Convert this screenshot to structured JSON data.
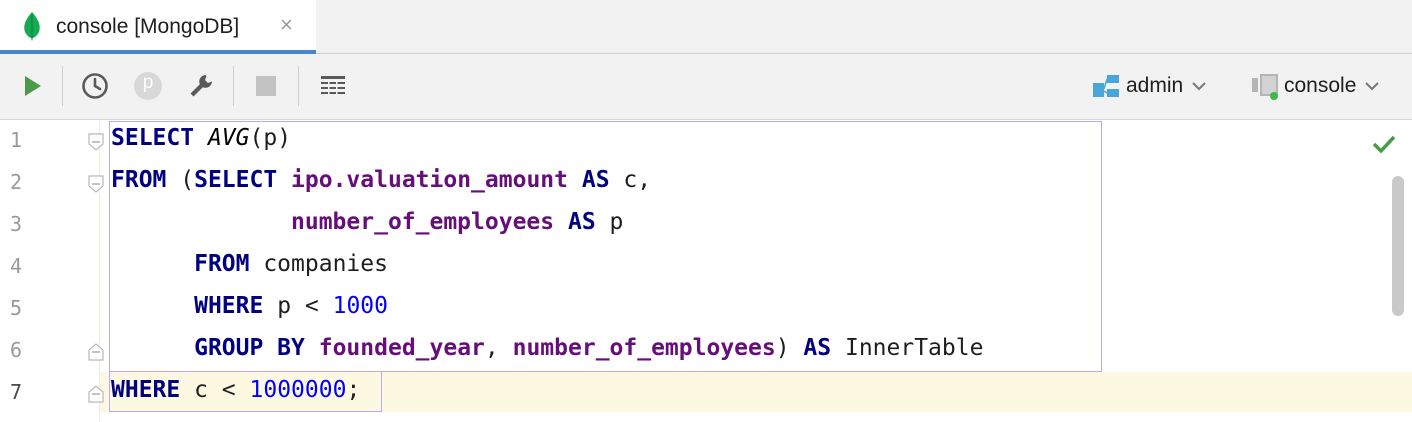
{
  "tab": {
    "label": "console [MongoDB]",
    "close": "×",
    "icon": "mongodb-leaf-icon"
  },
  "toolbar": {
    "param_label": "p",
    "db_selector": {
      "label": "admin",
      "icon": "schema-icon"
    },
    "console_selector": {
      "label": "console",
      "icon": "connection-icon"
    }
  },
  "editor": {
    "line_numbers": [
      "1",
      "2",
      "3",
      "4",
      "5",
      "6",
      "7"
    ],
    "lines": [
      {
        "tokens": [
          {
            "t": "SELECT",
            "c": "kw"
          },
          {
            "t": " ",
            "c": ""
          },
          {
            "t": "AVG",
            "c": "fn"
          },
          {
            "t": "(p)",
            "c": ""
          }
        ]
      },
      {
        "tokens": [
          {
            "t": "FROM",
            "c": "kw"
          },
          {
            "t": " (",
            "c": ""
          },
          {
            "t": "SELECT",
            "c": "kw"
          },
          {
            "t": " ",
            "c": ""
          },
          {
            "t": "ipo.valuation_amount",
            "c": "col"
          },
          {
            "t": " ",
            "c": ""
          },
          {
            "t": "AS",
            "c": "kw"
          },
          {
            "t": " c,",
            "c": ""
          }
        ]
      },
      {
        "tokens": [
          {
            "t": "             ",
            "c": ""
          },
          {
            "t": "number_of_employees",
            "c": "col"
          },
          {
            "t": " ",
            "c": ""
          },
          {
            "t": "AS",
            "c": "kw"
          },
          {
            "t": " p",
            "c": ""
          }
        ]
      },
      {
        "tokens": [
          {
            "t": "      ",
            "c": ""
          },
          {
            "t": "FROM",
            "c": "kw"
          },
          {
            "t": " companies",
            "c": ""
          }
        ]
      },
      {
        "tokens": [
          {
            "t": "      ",
            "c": ""
          },
          {
            "t": "WHERE",
            "c": "kw"
          },
          {
            "t": " p < ",
            "c": ""
          },
          {
            "t": "1000",
            "c": "num"
          }
        ]
      },
      {
        "tokens": [
          {
            "t": "      ",
            "c": ""
          },
          {
            "t": "GROUP BY",
            "c": "kw"
          },
          {
            "t": " ",
            "c": ""
          },
          {
            "t": "founded_year",
            "c": "col"
          },
          {
            "t": ", ",
            "c": ""
          },
          {
            "t": "number_of_employees",
            "c": "col"
          },
          {
            "t": ") ",
            "c": ""
          },
          {
            "t": "AS",
            "c": "kw"
          },
          {
            "t": " InnerTable",
            "c": ""
          }
        ]
      },
      {
        "tokens": [
          {
            "t": "WHERE",
            "c": "kw"
          },
          {
            "t": " c < ",
            "c": ""
          },
          {
            "t": "1000000",
            "c": "num"
          },
          {
            "t": ";",
            "c": ""
          }
        ]
      }
    ],
    "active_line": 7,
    "status_icon": "check-icon"
  },
  "colors": {
    "keyword": "#000080",
    "column": "#660e7a",
    "number": "#0000ff",
    "accent": "#4a86c8",
    "run": "#4a9a4a"
  }
}
